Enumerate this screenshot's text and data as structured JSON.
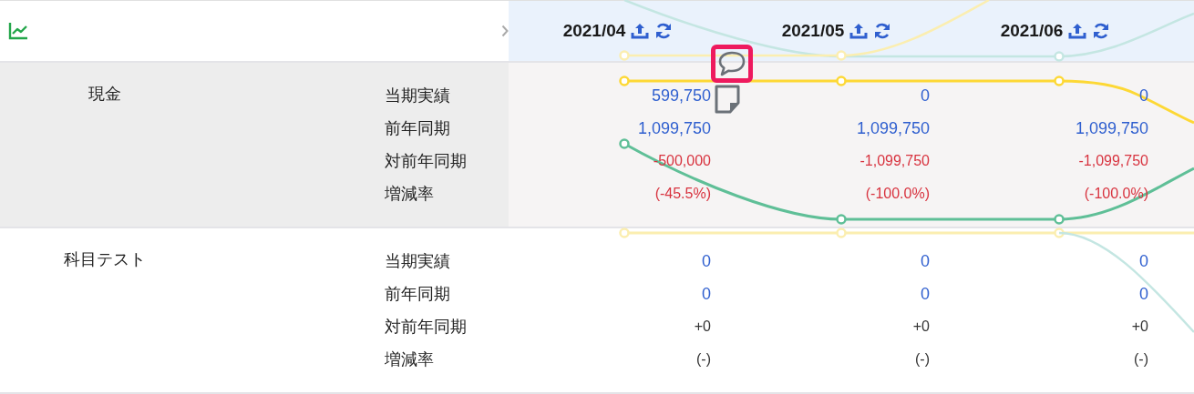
{
  "periods": [
    {
      "label": "2021/04"
    },
    {
      "label": "2021/05"
    },
    {
      "label": "2021/06"
    }
  ],
  "sections": [
    {
      "account": "現金",
      "selected": true,
      "rows": [
        {
          "label": "当期実績",
          "cells": [
            {
              "text": "599,750",
              "kind": "amount",
              "comment": true,
              "comment_focused": true,
              "attachment": true
            },
            {
              "text": "0",
              "kind": "amount"
            },
            {
              "text": "0",
              "kind": "amount"
            }
          ]
        },
        {
          "label": "前年同期",
          "cells": [
            {
              "text": "1,099,750",
              "kind": "amount"
            },
            {
              "text": "1,099,750",
              "kind": "amount"
            },
            {
              "text": "1,099,750",
              "kind": "amount"
            }
          ]
        },
        {
          "label": "対前年同期",
          "cells": [
            {
              "text": "-500,000",
              "kind": "negative"
            },
            {
              "text": "-1,099,750",
              "kind": "negative"
            },
            {
              "text": "-1,099,750",
              "kind": "negative"
            }
          ]
        },
        {
          "label": "増減率",
          "cells": [
            {
              "text": "(-45.5%)",
              "kind": "negative"
            },
            {
              "text": "(-100.0%)",
              "kind": "negative"
            },
            {
              "text": "(-100.0%)",
              "kind": "negative"
            }
          ]
        }
      ]
    },
    {
      "account": "科目テスト",
      "selected": false,
      "rows": [
        {
          "label": "当期実績",
          "cells": [
            {
              "text": "0",
              "kind": "amount"
            },
            {
              "text": "0",
              "kind": "amount"
            },
            {
              "text": "0",
              "kind": "amount"
            }
          ]
        },
        {
          "label": "前年同期",
          "cells": [
            {
              "text": "0",
              "kind": "amount"
            },
            {
              "text": "0",
              "kind": "amount"
            },
            {
              "text": "0",
              "kind": "amount"
            }
          ]
        },
        {
          "label": "対前年同期",
          "cells": [
            {
              "text": "+0",
              "kind": "neutral"
            },
            {
              "text": "+0",
              "kind": "neutral"
            },
            {
              "text": "+0",
              "kind": "neutral"
            }
          ]
        },
        {
          "label": "増減率",
          "cells": [
            {
              "text": "(-)",
              "kind": "neutral"
            },
            {
              "text": "(-)",
              "kind": "neutral"
            },
            {
              "text": "(-)",
              "kind": "neutral"
            }
          ]
        }
      ]
    }
  ]
}
